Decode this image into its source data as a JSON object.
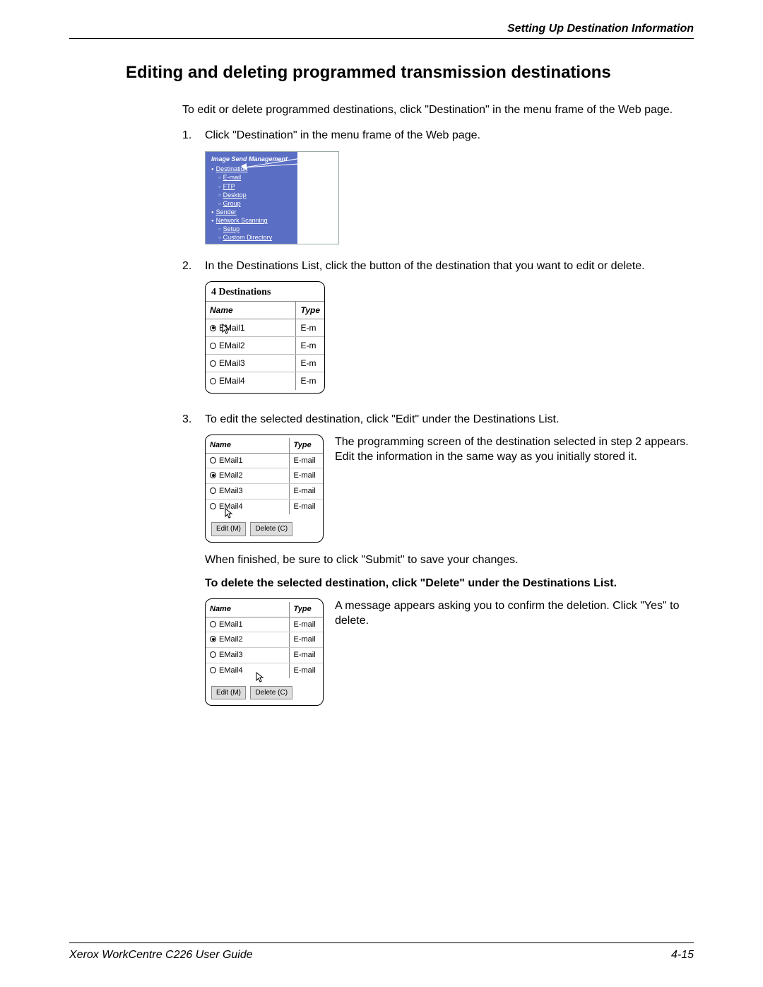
{
  "header": {
    "section": "Setting Up Destination Information"
  },
  "title": "Editing and deleting programmed transmission destinations",
  "intro": "To edit or delete programmed destinations, click \"Destination\" in the menu frame of the Web page.",
  "steps": {
    "s1": "Click \"Destination\" in the menu frame of the Web page.",
    "s2": "In the Destinations List, click the button of the destination that you want to edit or delete.",
    "s3": "To edit the selected destination, click \"Edit\" under the Destinations List."
  },
  "fig_menu": {
    "title": "Image Send Management",
    "items": {
      "destination": "Destination",
      "email": "E-mail",
      "ftp": "FTP",
      "desktop": "Desktop",
      "group": "Group",
      "sender": "Sender",
      "netscan": "Network Scanning",
      "setup": "Setup",
      "customdir": "Custom Directory"
    }
  },
  "fig_dest": {
    "count_label": "4 Destinations",
    "col_name": "Name",
    "col_type": "Type",
    "rows": [
      {
        "name": "EMail1",
        "type": "E-m",
        "selected": true
      },
      {
        "name": "EMail2",
        "type": "E-m",
        "selected": false
      },
      {
        "name": "EMail3",
        "type": "E-m",
        "selected": false
      },
      {
        "name": "EMail4",
        "type": "E-m",
        "selected": false
      }
    ]
  },
  "fig_list": {
    "col_name": "Name",
    "col_type": "Type",
    "rows": [
      {
        "name": "EMail1",
        "type": "E-mail",
        "selected": false
      },
      {
        "name": "EMail2",
        "type": "E-mail",
        "selected": true
      },
      {
        "name": "EMail3",
        "type": "E-mail",
        "selected": false
      },
      {
        "name": "EMail4",
        "type": "E-mail",
        "selected": false
      }
    ],
    "edit_btn": "Edit (M)",
    "delete_btn": "Delete (C)"
  },
  "aside_edit": "The programming screen of the destination selected in step 2 appears. Edit the information in the same way as you initially stored it.",
  "after_edit": "When finished, be sure to click \"Submit\" to save your changes.",
  "delete_note": "To delete the selected destination, click \"Delete\" under the Destinations List.",
  "aside_delete": "A message appears asking you to confirm the deletion. Click \"Yes\" to delete.",
  "footer": {
    "guide": "Xerox WorkCentre C226 User Guide",
    "page": "4-15"
  }
}
